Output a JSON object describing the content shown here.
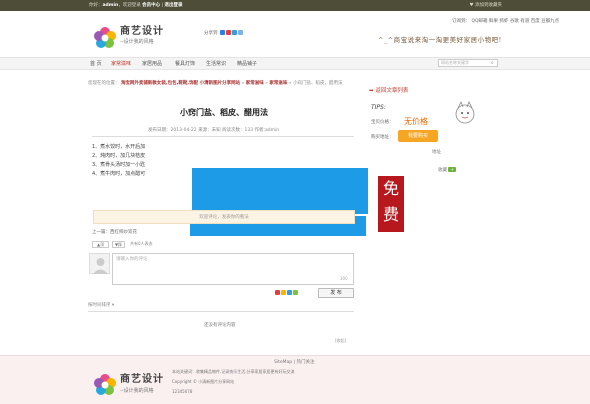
{
  "topbar": {
    "greeting": "你好：",
    "user": "admin",
    "welcome": "，欢迎登录",
    "member_center": "会员中心",
    "logout": "退出登录",
    "bookmark": "添加到收藏夹"
  },
  "header": {
    "site_name": "商艺设计",
    "slogan": "--设计我的风格",
    "share_label": "分享到",
    "links": [
      "订阅到：",
      "QQ邮箱",
      "鲜果",
      "抓虾",
      "谷歌",
      "有道",
      "百度",
      "豆瓣九点"
    ],
    "tagline": "^_^商宝说来淘一淘更美好家居小物吧!"
  },
  "nav": {
    "items": [
      "首 页",
      "家常滋味",
      "家居用品",
      "餐具灯饰",
      "生活常识",
      "精品铺子"
    ],
    "active_index": 1,
    "search_placeholder": "网站名称关键字"
  },
  "breadcrumb": {
    "prefix": "您现在的位置：",
    "path": "淘宝网外卖铺新款女装,包包,鞋靴,饰配 小清新图片分享网站",
    "sep": "»",
    "c1": "家常滋味",
    "c2": "家常滋味",
    "current": "小窍门盐、稻皮、醋用法"
  },
  "article": {
    "title": "小窍门盐、稻皮、醋用法",
    "meta": "发布日期：2013-04-22  来源：未知  阅读次数：133  作者:admin",
    "lines": [
      "1、煮水饺时，水开后加",
      "2、炖肉时，加几块桔皮",
      "3、煮骨头汤时加一小匙",
      "4、煮牛肉时，加点醋可"
    ],
    "notice": "欢迎评论，发表你的看法",
    "prev_label": "上一篇：西红柿炒双花",
    "like_label": "顶",
    "dislike_label": "踩",
    "likes_text": "共有0人表态"
  },
  "sidebar": {
    "back_link": "返回文章列表",
    "tips": "TIPS:",
    "price_label": "宝贝价格：",
    "price": "无价格",
    "buy_label": "购买地址：",
    "buy_button": "我要购买",
    "extra1": "地址",
    "extra2": "收藏"
  },
  "ad": {
    "free_text": "免费"
  },
  "comment": {
    "placeholder": "请输入你的评论",
    "counter": "300",
    "post": "发 布",
    "order": "按时间排序 ▾",
    "empty": "还没有评论内容",
    "collapse": "[收起]"
  },
  "footer": {
    "links": "SiteMap | 热门关注",
    "site_name": "商艺设计",
    "slogan": "--设计我的风格",
    "line1": "本站关键词：收集精品物件,记录快乐生活,分享家居家居更有好玩交流",
    "line2": "Copyright © 小清新图片分享网站",
    "line3": "12345678"
  },
  "colors": {
    "topbar": "#4d4d38",
    "accent": "#c0392b",
    "price": "#e56b00",
    "ad_blue": "#1e9be6",
    "stamp": "#b7181e",
    "buy": "#f5a623"
  }
}
